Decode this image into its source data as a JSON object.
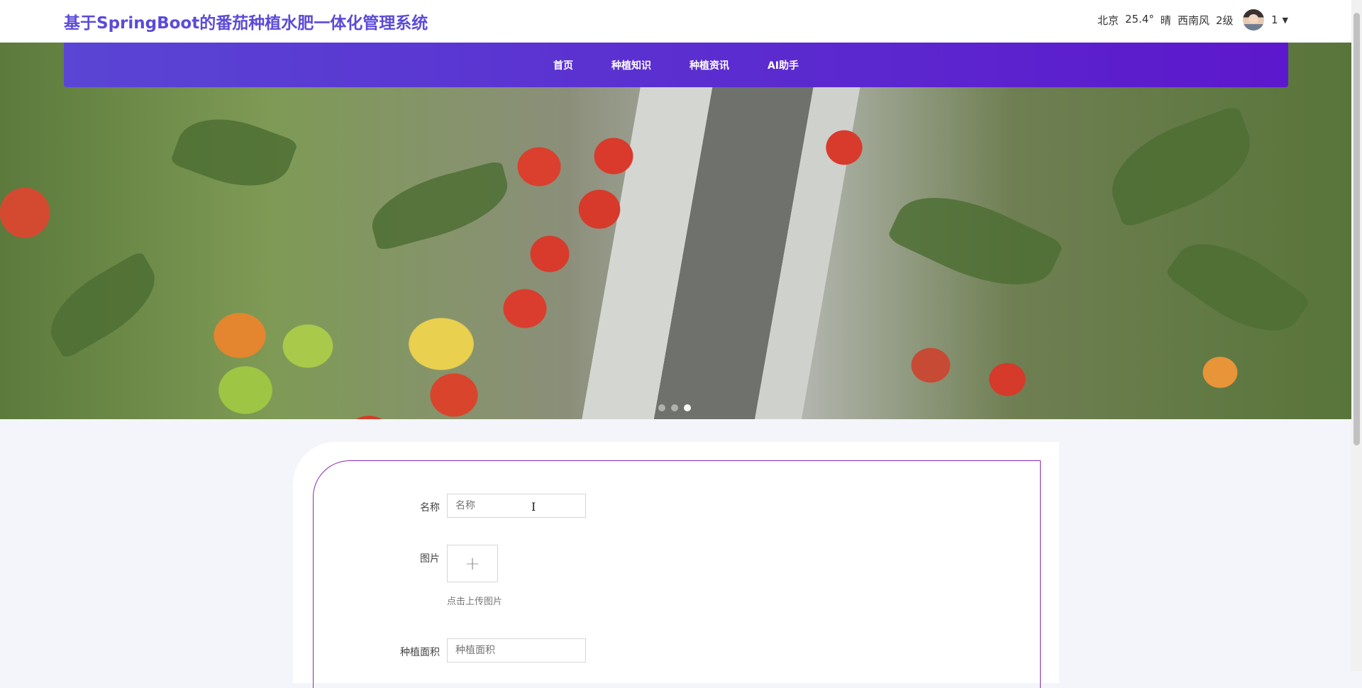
{
  "header": {
    "title": "基于SpringBoot的番茄种植水肥一体化管理系统",
    "weather": {
      "city": "北京",
      "temperature": "25.4°",
      "condition": "晴",
      "wind": "西南风",
      "wind_level": "2级"
    },
    "user": {
      "name": "1",
      "avatar_icon": "user-avatar",
      "caret_icon": "caret-down-icon"
    },
    "accent_color": "#5b4bd8"
  },
  "nav": {
    "items": [
      {
        "label": "首页"
      },
      {
        "label": "种植知识"
      },
      {
        "label": "种植资讯"
      },
      {
        "label": "AI助手"
      }
    ],
    "gradient": [
      "#5a45d4",
      "#5c18cc"
    ]
  },
  "carousel": {
    "slide_count": 3,
    "active_index": 2
  },
  "form": {
    "border_color": "#8a2bb0",
    "fields": {
      "name": {
        "label": "名称",
        "placeholder": "名称"
      },
      "image": {
        "label": "图片",
        "upload_icon": "plus-icon",
        "hint": "点击上传图片"
      },
      "area": {
        "label": "种植面积",
        "placeholder": "种植面积"
      }
    }
  }
}
